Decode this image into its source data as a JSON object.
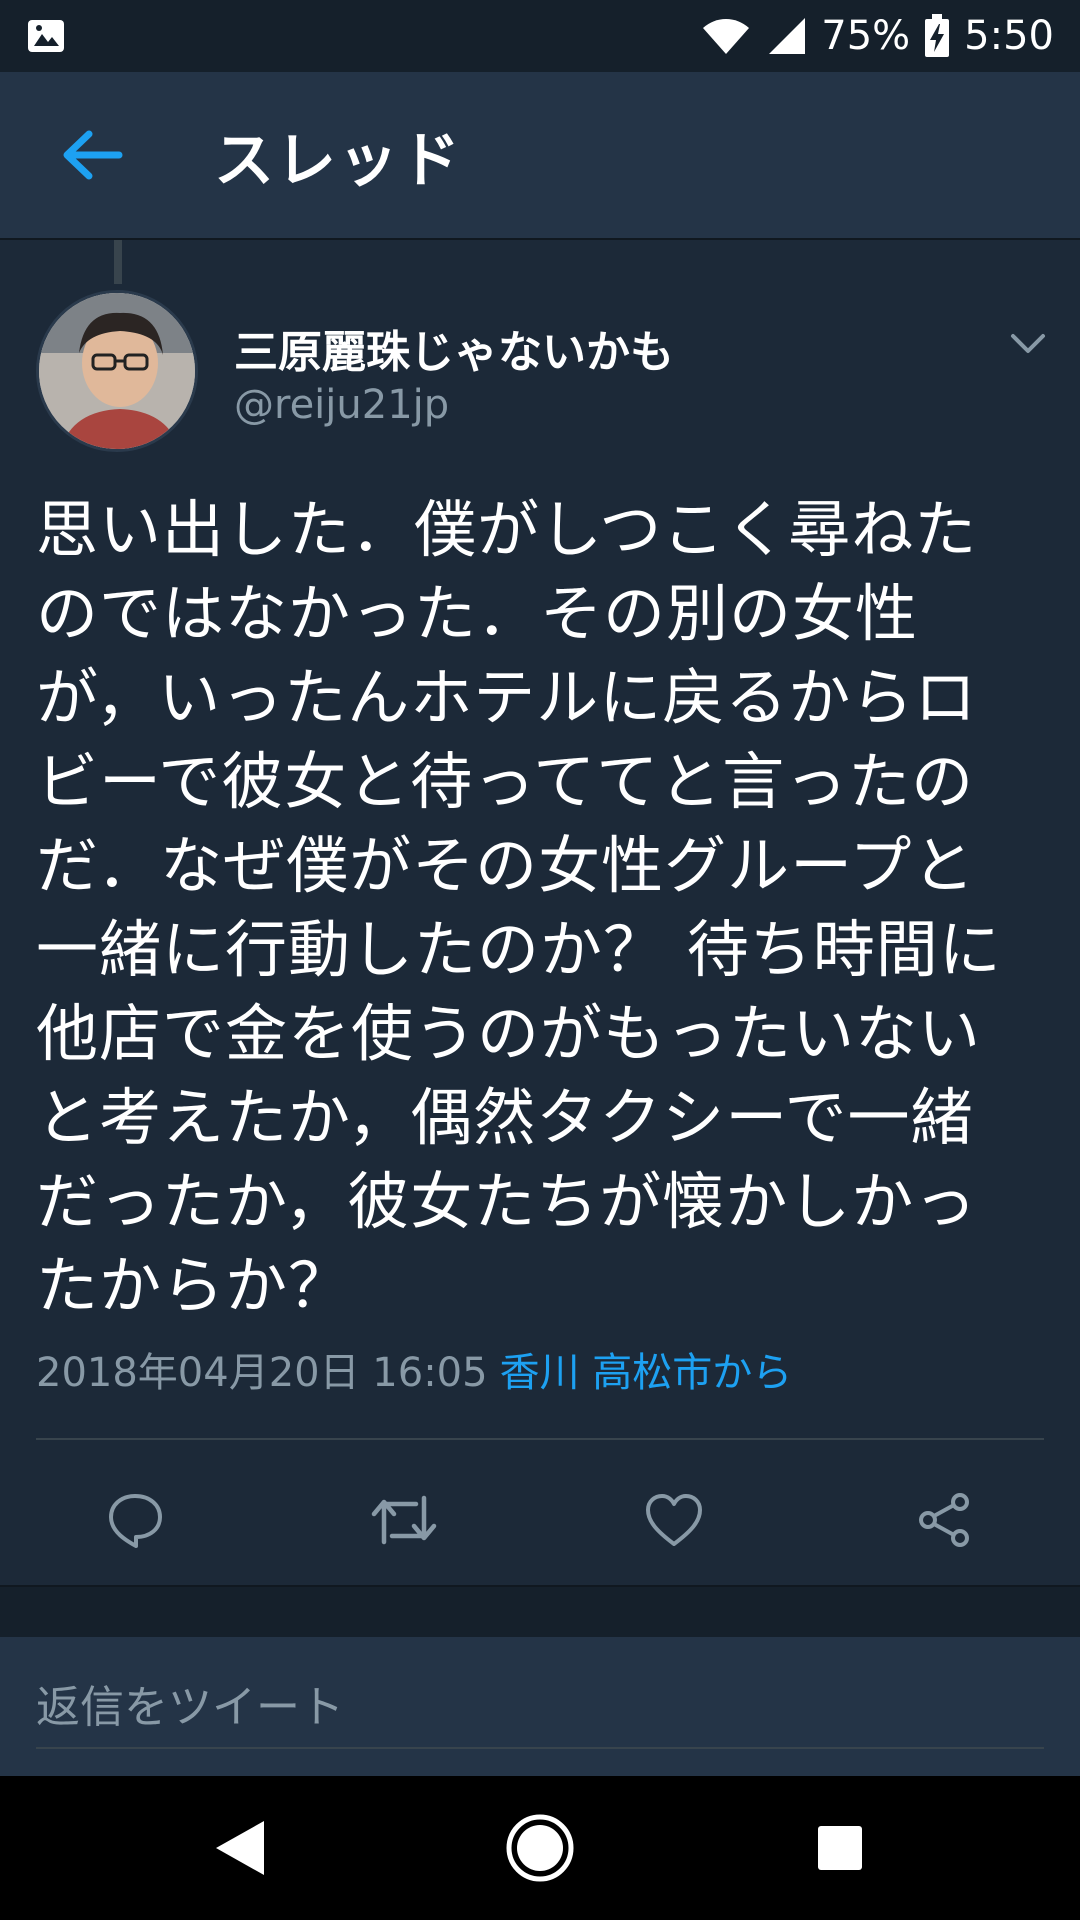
{
  "status_bar": {
    "battery": "75%",
    "time": "5:50"
  },
  "header": {
    "title": "スレッド"
  },
  "tweet": {
    "author_name": "三原麗珠じゃないかも",
    "author_handle": "@reiju21jp",
    "text": "思い出した．僕がしつこく尋ねた\nのではなかった．その別の女性\nが，いったんホテルに戻るからロ\nビーで彼女と待っててと言ったの\nだ．なぜ僕がその女性グループと\n一緒に行動したのか？ 待ち時間に\n他店で金を使うのがもったいない\nと考えたか，偶然タクシーで一緒\nだったか，彼女たちが懐かしかっ\nたからか？",
    "timestamp": "2018年04月20日 16:05",
    "location": "香川 高松市から"
  },
  "reply": {
    "placeholder": "返信をツイート"
  },
  "colors": {
    "background": "#15202b",
    "card": "#1c2938",
    "header": "#243447",
    "accent": "#1da1f2",
    "secondary_text": "#8899a6"
  },
  "icons": {
    "back": "arrow-left-icon",
    "caret": "chevron-down-icon",
    "reply": "comment-icon",
    "retweet": "retweet-icon",
    "like": "heart-icon",
    "share": "share-icon"
  }
}
